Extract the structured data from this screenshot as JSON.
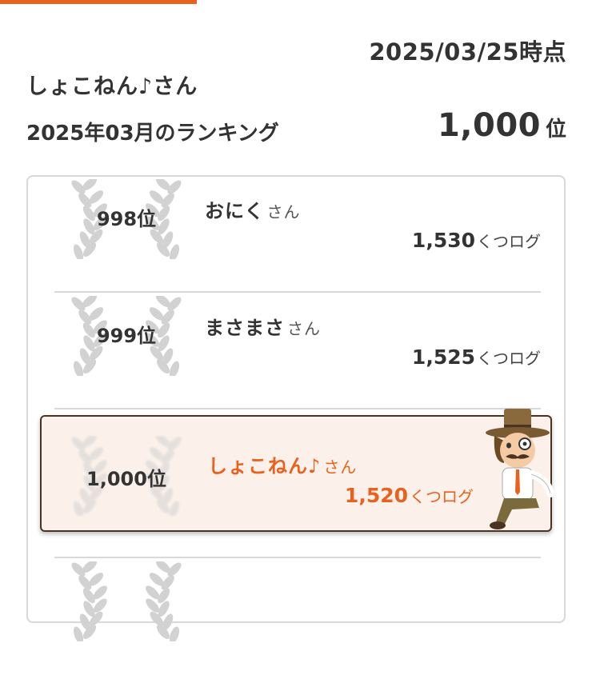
{
  "header": {
    "date": "2025/03/25時点",
    "user_name": "しょこねん♪さん",
    "ranking_title": "2025年03月のランキング",
    "my_rank_value": "1,000",
    "my_rank_unit": "位"
  },
  "ranking": {
    "honorific": "さん",
    "score_unit": "くつログ",
    "rows": [
      {
        "rank": "998位",
        "name": "おにく",
        "score": "1,530"
      },
      {
        "rank": "999位",
        "name": "まさまさ",
        "score": "1,525"
      },
      {
        "rank": "1,000位",
        "name": "しょこねん♪",
        "score": "1,520",
        "highlighted": true
      },
      {
        "rank": "",
        "name": "",
        "score": ""
      }
    ]
  },
  "colors": {
    "accent": "#e8611f",
    "highlight_bg": "#fbf1ea",
    "highlight_border": "#4a3421",
    "laurel": "#d2d2d2"
  },
  "icons": {
    "laurel": "laurel-wreath-icon",
    "mascot": "detective-mascot-icon"
  }
}
